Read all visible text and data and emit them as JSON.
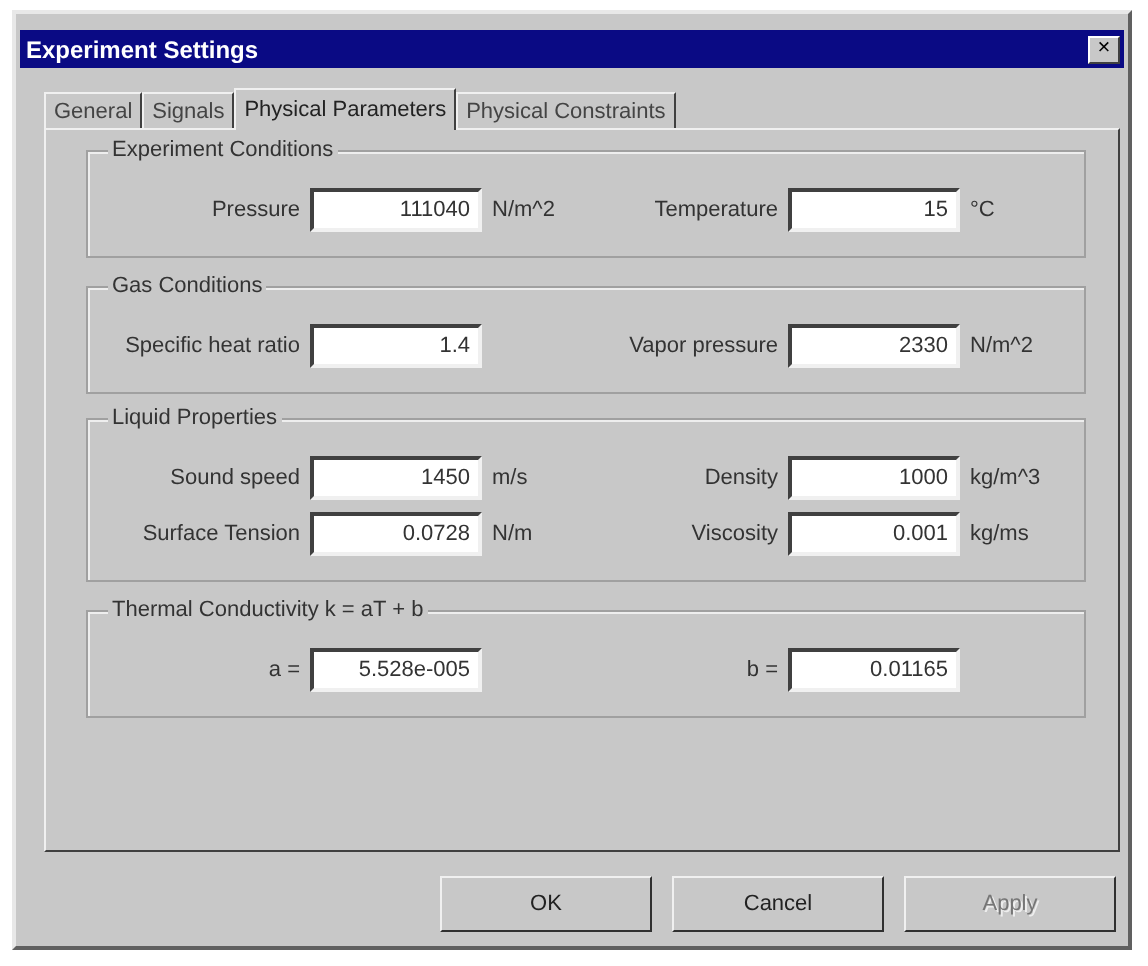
{
  "window": {
    "title": "Experiment Settings",
    "close": "×"
  },
  "tabs": [
    {
      "label": "General",
      "selected": false
    },
    {
      "label": "Signals",
      "selected": false
    },
    {
      "label": "Physical Parameters",
      "selected": true
    },
    {
      "label": "Physical Constraints",
      "selected": false
    }
  ],
  "groups": [
    {
      "title": "Experiment Conditions",
      "rows": [
        [
          {
            "label": "Pressure",
            "value": "111040",
            "unit": "N/m^2"
          },
          {
            "label": "Temperature",
            "value": "15",
            "unit": "°C"
          }
        ]
      ]
    },
    {
      "title": "Gas Conditions",
      "rows": [
        [
          {
            "label": "Specific heat ratio",
            "value": "1.4"
          },
          {
            "label": "Vapor pressure",
            "value": "2330",
            "unit": "N/m^2"
          }
        ]
      ]
    },
    {
      "title": "Liquid Properties",
      "rows": [
        [
          {
            "label": "Sound speed",
            "value": "1450",
            "unit": "m/s"
          },
          {
            "label": "Density",
            "value": "1000",
            "unit": "kg/m^3"
          }
        ],
        [
          {
            "label": "Surface Tension",
            "value": "0.0728",
            "unit": "N/m"
          },
          {
            "label": "Viscosity",
            "value": "0.001",
            "unit": "kg/ms"
          }
        ]
      ]
    },
    {
      "title": "Thermal Conductivity k = aT + b",
      "rows": [
        [
          {
            "label": "a =",
            "value": "5.528e-005"
          },
          {
            "label": "b =",
            "value": "0.01165"
          }
        ]
      ]
    }
  ],
  "buttons": [
    {
      "label": "OK",
      "disabled": false
    },
    {
      "label": "Cancel",
      "disabled": false
    },
    {
      "label": "Apply",
      "disabled": true
    }
  ]
}
